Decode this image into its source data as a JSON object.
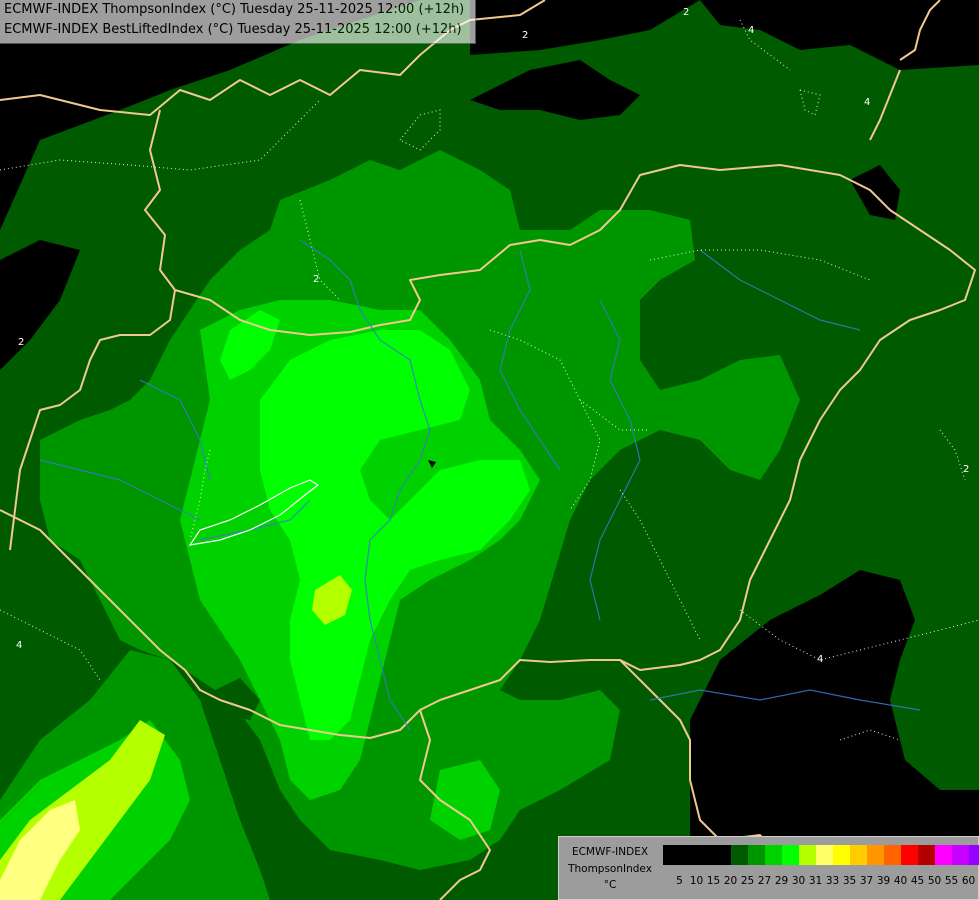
{
  "title": {
    "line1": "ECMWF-INDEX ThompsonIndex (°C) Tuesday 25-11-2025 12:00 (+12h)",
    "line2": "ECMWF-INDEX BestLiftedIndex (°C) Tuesday 25-11-2025 12:00 (+12h)"
  },
  "legend": {
    "line1": "ECMWF-INDEX",
    "line2": "ThompsonIndex",
    "unit": "°C",
    "ticks": [
      "5",
      "10",
      "15",
      "20",
      "25",
      "27",
      "29",
      "30",
      "31",
      "33",
      "35",
      "37",
      "39",
      "40",
      "45",
      "50",
      "55",
      "60"
    ],
    "colors": [
      "#000000",
      "#000000",
      "#000000",
      "#000000",
      "#005a00",
      "#009600",
      "#00d200",
      "#00ff00",
      "#b4ff00",
      "#ffff66",
      "#ffff00",
      "#ffcc00",
      "#ff9600",
      "#ff6400",
      "#ff0000",
      "#b40000",
      "#ff00ff",
      "#c800ff",
      "#9600ff",
      "#6400ff",
      "#0000ff"
    ]
  },
  "contour_labels": [
    "2",
    "2",
    "2",
    "2",
    "4",
    "4",
    "4",
    "4",
    "2",
    "4"
  ],
  "colors": {
    "ocean_black": "#000000",
    "dark_green": "#005a00",
    "mid_green": "#009600",
    "bright_green": "#00d200",
    "neon_green": "#00ff00",
    "lime": "#b4ff00",
    "yellow": "#ffff80",
    "border": "#f0c890",
    "river": "#3a78c8"
  }
}
